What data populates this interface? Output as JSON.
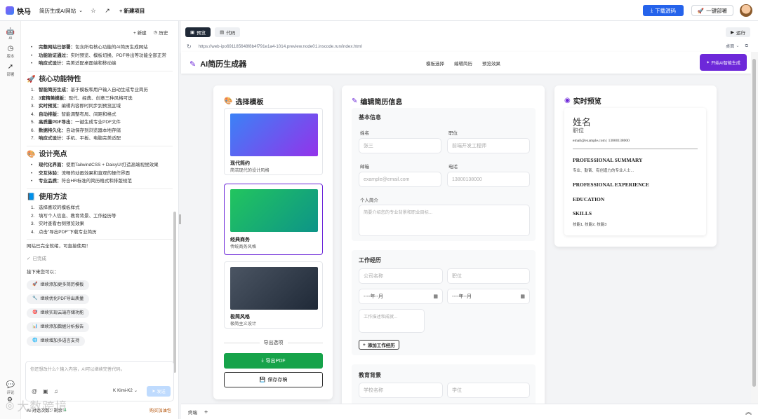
{
  "topbar": {
    "brand": "快马",
    "project_name": "简历生成AI网站",
    "new_project": "+ 新建项目",
    "download": "下载源码",
    "deploy": "一键部署"
  },
  "rail": {
    "ai": "AI",
    "version": "版本",
    "deploy": "部署",
    "comment": "评论"
  },
  "chat": {
    "new_btn": "+ 新建",
    "history_btn": "历史",
    "intro": [
      {
        "b": "完整网站已部署：",
        "t": "包含所有核心功能的AI简历生成网站"
      },
      {
        "b": "功能验证通过：",
        "t": "实时预览、模板切换、PDF导出等功能全部正常"
      },
      {
        "b": "响应式设计：",
        "t": "完美适配桌面端和移动端"
      }
    ],
    "h_features": "核心功能特性",
    "features": [
      {
        "b": "智能简历生成：",
        "t": "基于模板和用户输入自动生成专业简历"
      },
      {
        "b": "3套精美模板：",
        "t": "现代、经典、创意三种风格可选"
      },
      {
        "b": "实时预览：",
        "t": "编辑内容即时同步到预览区域"
      },
      {
        "b": "自动排版：",
        "t": "智能调整布局、间距和格式"
      },
      {
        "b": "高质量PDF导出：",
        "t": "一键生成专业PDF文件"
      },
      {
        "b": "数据持久化：",
        "t": "自动保存到浏览器本地存储"
      },
      {
        "b": "响应式设计：",
        "t": "手机、平板、电脑完美适配"
      }
    ],
    "h_design": "设计亮点",
    "design": [
      {
        "b": "现代化界面：",
        "t": "使用TailwindCSS + DaisyUI打造高端视觉效果"
      },
      {
        "b": "交互体验：",
        "t": "流畅的动画效果和直观的操作界面"
      },
      {
        "b": "专业品质：",
        "t": "符合HR标准的简历格式和排版规范"
      }
    ],
    "h_usage": "使用方法",
    "usage": [
      "选择喜欢的模板样式",
      "填写个人信息、教育背景、工作经历等",
      "实时查看右侧预览效果",
      "点击\"导出PDF\"下载专业简历"
    ],
    "ready": "网站已完全就绪，可直接使用！",
    "done": "已完成",
    "next": "接下来您可以：",
    "suggestions": [
      {
        "icon": "🚀",
        "text": "继续添加更多简历模板"
      },
      {
        "icon": "🔧",
        "text": "继续优化PDF导出质量"
      },
      {
        "icon": "🎯",
        "text": "继续实现云端存储功能"
      },
      {
        "icon": "📊",
        "text": "继续添加数据分析报告"
      },
      {
        "icon": "🌐",
        "text": "继续增加多语言支持"
      }
    ],
    "input_placeholder": "你还想改什么? 输入内容，AI可以继续完善代码。",
    "model": "Kimi-K2",
    "send": "发送",
    "quota": "AI 对话次数：剩余",
    "quota_count": "4",
    "buy": "购买加油包"
  },
  "pane": {
    "tab_preview": "预览",
    "tab_code": "代码",
    "run": "运行",
    "url": "https://web-ipo691185648f8b4f791e1a4-1014.preview.node01.inscode.run/index.html",
    "device": "桌面",
    "terminal": "终端",
    "plus": "+"
  },
  "app": {
    "title": "AI简历生成器",
    "nav": [
      "模板选择",
      "编辑简历",
      "预览效果"
    ],
    "start_btn": "开始AI智能生成",
    "template_card": {
      "title": "选择模板",
      "templates": [
        {
          "name": "现代简约",
          "desc": "简洁现代的设计风格",
          "c1": "#3b82f6",
          "c2": "#9333ea"
        },
        {
          "name": "经典商务",
          "desc": "传统商务风格",
          "c1": "#22c55e",
          "c2": "#0d9488"
        },
        {
          "name": "极简风格",
          "desc": "极简主义设计",
          "c1": "#4b5563",
          "c2": "#1f2937"
        }
      ],
      "export_label": "导出选项",
      "export_pdf": "导出PDF",
      "save": "保存存稿"
    },
    "edit_card": {
      "title": "编辑简历信息",
      "basic_title": "基本信息",
      "name_label": "姓名",
      "name_ph": "张三",
      "position_label": "职位",
      "position_ph": "前端开发工程师",
      "email_label": "邮箱",
      "email_ph": "example@email.com",
      "phone_label": "电话",
      "phone_ph": "13800138000",
      "summary_label": "个人简介",
      "summary_ph": "简要介绍您的专业背景和职业目标...",
      "work_title": "工作经历",
      "company_ph": "公司名称",
      "job_ph": "职位",
      "month_ph": "----年--月",
      "work_desc_ph": "工作描述和成就...",
      "add_work": "添加工作经历",
      "edu_title": "教育背景",
      "school_ph": "学校名称",
      "degree_ph": "学位"
    },
    "preview_card": {
      "title": "实时预览",
      "name": "姓名",
      "position": "职位",
      "contact": "email@example.com | 13800138000",
      "summary_h": "PROFESSIONAL SUMMARY",
      "summary_t": "专业、勤奋、有创造力的专业人士...",
      "exp_h": "PROFESSIONAL EXPERIENCE",
      "edu_h": "EDUCATION",
      "skills_h": "SKILLS",
      "skills_t": "技能1, 技能2, 技能3"
    }
  },
  "watermark": "大数跨境",
  "colors": {
    "accent": "#2563eb",
    "purple": "#6d28d9",
    "green": "#16a34a"
  }
}
